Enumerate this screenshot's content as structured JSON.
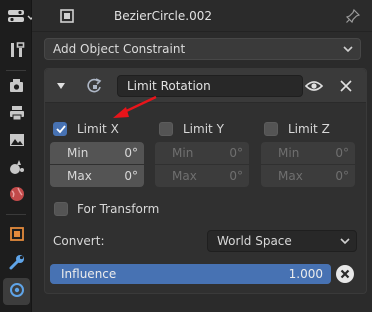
{
  "header": {
    "object_name": "BezierCircle.002",
    "icons": [
      "editor-type-icon",
      "chevron-down-icon",
      "object-data-icon",
      "pin-icon"
    ]
  },
  "tabs": [
    {
      "name": "tool",
      "icon": "wrench-screwdriver-icon"
    },
    {
      "name": "render",
      "icon": "camera-back-icon"
    },
    {
      "name": "output",
      "icon": "printer-icon"
    },
    {
      "name": "view-layer",
      "icon": "image-icon"
    },
    {
      "name": "scene",
      "icon": "scene-icon"
    },
    {
      "name": "world",
      "icon": "world-icon"
    },
    {
      "name": "object",
      "icon": "object-square-icon"
    },
    {
      "name": "modifiers",
      "icon": "wrench-icon"
    },
    {
      "name": "object-constraint",
      "icon": "constraint-icon",
      "active": true
    }
  ],
  "add_constraint": {
    "label": "Add Object Constraint"
  },
  "constraint": {
    "name": "Limit Rotation",
    "limit_x": {
      "label": "Limit X",
      "checked": true,
      "min_label": "Min",
      "min_value": "0°",
      "max_label": "Max",
      "max_value": "0°"
    },
    "limit_y": {
      "label": "Limit Y",
      "checked": false,
      "min_label": "Min",
      "min_value": "0°",
      "max_label": "Max",
      "max_value": "0°"
    },
    "limit_z": {
      "label": "Limit Z",
      "checked": false,
      "min_label": "Min",
      "min_value": "0°",
      "max_label": "Max",
      "max_value": "0°"
    },
    "for_transform": {
      "label": "For Transform",
      "checked": false
    },
    "convert": {
      "label": "Convert:",
      "value": "World Space"
    },
    "influence": {
      "label": "Influence",
      "value": "1.000",
      "fraction": 1.0
    }
  },
  "colors": {
    "accent": "#4772b3",
    "annotation_arrow": "#e8141a"
  }
}
